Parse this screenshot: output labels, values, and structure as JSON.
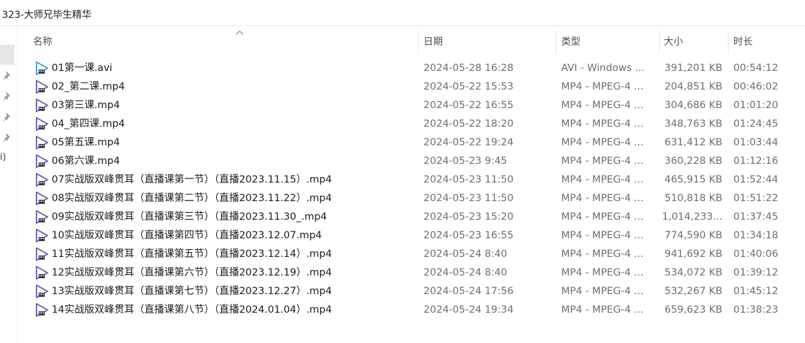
{
  "breadcrumb": {
    "path": "323-大师兄毕生精华"
  },
  "nav": {
    "partial_label": "ⅰ)"
  },
  "columns": {
    "name": "名称",
    "date": "日期",
    "type": "类型",
    "size": "大小",
    "duration": "时长"
  },
  "colors": {
    "video_icon": "#6b4fbb",
    "avi_icon": "#2f9be0"
  },
  "files": [
    {
      "name": "01第一课.avi",
      "date": "2024-05-28 16:28",
      "type": "AVI - Windows ...",
      "size": "391,201 KB",
      "duration": "00:54:12",
      "icon": "avi-video-icon"
    },
    {
      "name": "02_第二课.mp4",
      "date": "2024-05-22 15:53",
      "type": "MP4 - MPEG-4 ...",
      "size": "204,851 KB",
      "duration": "00:46:02",
      "icon": "mp4-video-icon"
    },
    {
      "name": "03第三课.mp4",
      "date": "2024-05-22 16:55",
      "type": "MP4 - MPEG-4 ...",
      "size": "304,686 KB",
      "duration": "01:01:20",
      "icon": "mp4-video-icon"
    },
    {
      "name": "04_第四课.mp4",
      "date": "2024-05-22 18:20",
      "type": "MP4 - MPEG-4 ...",
      "size": "348,763 KB",
      "duration": "01:24:45",
      "icon": "mp4-video-icon"
    },
    {
      "name": "05第五课.mp4",
      "date": "2024-05-22 19:24",
      "type": "MP4 - MPEG-4 ...",
      "size": "631,412 KB",
      "duration": "01:03:44",
      "icon": "mp4-video-icon"
    },
    {
      "name": "06第六课.mp4",
      "date": "2024-05-23 9:45",
      "type": "MP4 - MPEG-4 ...",
      "size": "360,228 KB",
      "duration": "01:12:16",
      "icon": "mp4-video-icon"
    },
    {
      "name": "07实战版双峰贯耳（直播课第一节）（直播2023.11.15）.mp4",
      "date": "2024-05-23 11:50",
      "type": "MP4 - MPEG-4 ...",
      "size": "465,915 KB",
      "duration": "01:52:44",
      "icon": "mp4-video-icon"
    },
    {
      "name": "08实战版双峰贯耳（直播课第二节）（直播2023.11.22）.mp4",
      "date": "2024-05-23 11:50",
      "type": "MP4 - MPEG-4 ...",
      "size": "510,818 KB",
      "duration": "01:51:22",
      "icon": "mp4-video-icon"
    },
    {
      "name": "09实战版双峰贯耳（直播课第三节）（直播2023.11.30_.mp4",
      "date": "2024-05-23 15:20",
      "type": "MP4 - MPEG-4 ...",
      "size": "1,014,233...",
      "duration": "01:37:45",
      "icon": "mp4-video-icon"
    },
    {
      "name": "10实战版双峰贯耳（直播课第四节）（直播2023.12.07.mp4",
      "date": "2024-05-23 16:55",
      "type": "MP4 - MPEG-4 ...",
      "size": "774,590 KB",
      "duration": "01:34:18",
      "icon": "mp4-video-icon"
    },
    {
      "name": "11实战版双峰贯耳（直播课第五节）（直播2023.12.14）.mp4",
      "date": "2024-05-24 8:40",
      "type": "MP4 - MPEG-4 ...",
      "size": "941,692 KB",
      "duration": "01:40:06",
      "icon": "mp4-video-icon"
    },
    {
      "name": "12实战版双峰贯耳（直播课第六节）（直播2023.12.19）.mp4",
      "date": "2024-05-24 8:40",
      "type": "MP4 - MPEG-4 ...",
      "size": "534,072 KB",
      "duration": "01:39:12",
      "icon": "mp4-video-icon"
    },
    {
      "name": "13实战版双峰贯耳（直播课第七节）（直播2023.12.27）.mp4",
      "date": "2024-05-24 17:56",
      "type": "MP4 - MPEG-4 ...",
      "size": "532,267 KB",
      "duration": "01:45:12",
      "icon": "mp4-video-icon"
    },
    {
      "name": "14实战版双峰贯耳（直播课第八节）（直播2024.01.04）.mp4",
      "date": "2024-05-24 19:34",
      "type": "MP4 - MPEG-4 ...",
      "size": "659,623 KB",
      "duration": "01:38:23",
      "icon": "mp4-video-icon"
    }
  ]
}
